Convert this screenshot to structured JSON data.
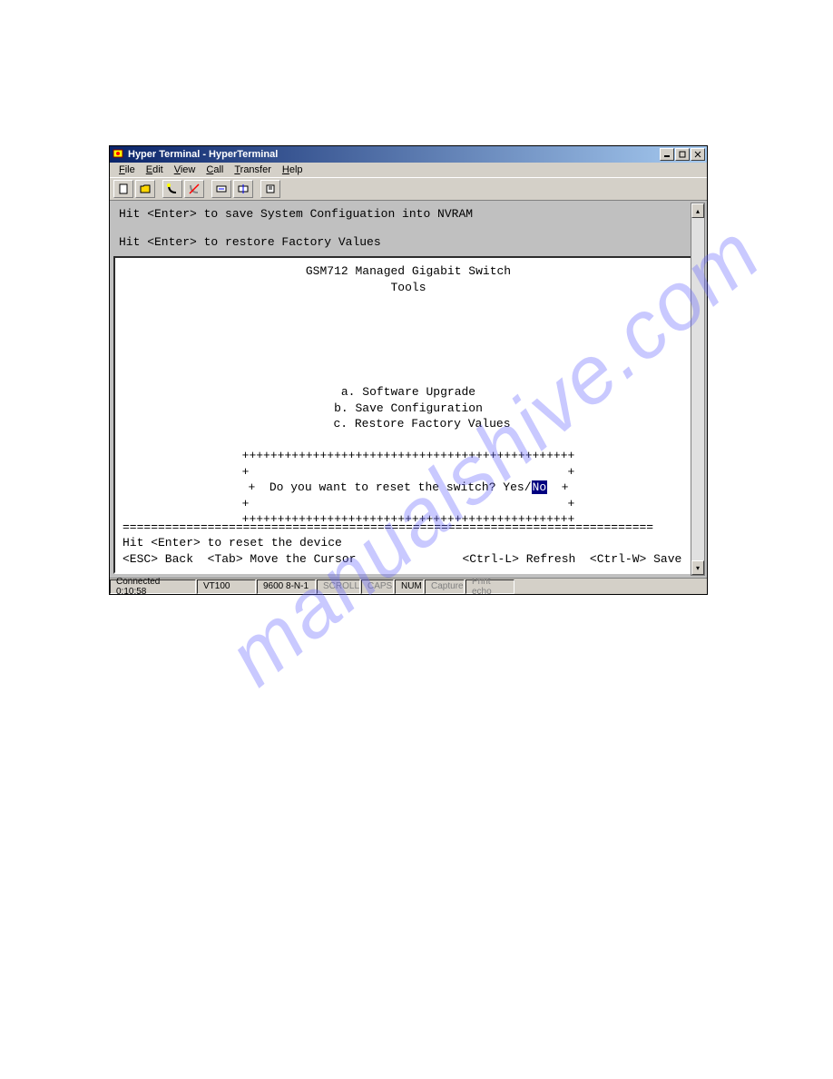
{
  "titlebar": {
    "text": "Hyper Terminal - HyperTerminal"
  },
  "menubar": [
    "File",
    "Edit",
    "View",
    "Call",
    "Transfer",
    "Help"
  ],
  "terminal": {
    "top_line1": "Hit <Enter> to save System Configuation into NVRAM",
    "top_line2": "Hit <Enter> to restore Factory Values",
    "header1": "GSM712 Managed Gigabit Switch",
    "header2": "Tools",
    "opt_a": "a. Software Upgrade",
    "opt_b": "b. Save Configuration",
    "opt_c": "c. Restore Factory Values",
    "border": "+++++++++++++++++++++++++++++++++++++++++++++++",
    "dialog_empty": "+                                             +",
    "dialog_q": "+  Do you want to reset the switch? Yes/",
    "dialog_highlight": "No",
    "dialog_end": "  +",
    "divider": "===========================================================================",
    "footer1": "Hit <Enter> to reset the device",
    "footer2_left": "<ESC> Back  <Tab> Move the Cursor",
    "footer2_right": "<Ctrl-L> Refresh  <Ctrl-W> Save"
  },
  "statusbar": {
    "connected": "Connected 0:10:58",
    "emulation": "VT100",
    "baud": "9600 8-N-1",
    "scroll": "SCROLL",
    "caps": "CAPS",
    "num": "NUM",
    "capture": "Capture",
    "print": "Print echo"
  },
  "watermark": "manualshive.com"
}
